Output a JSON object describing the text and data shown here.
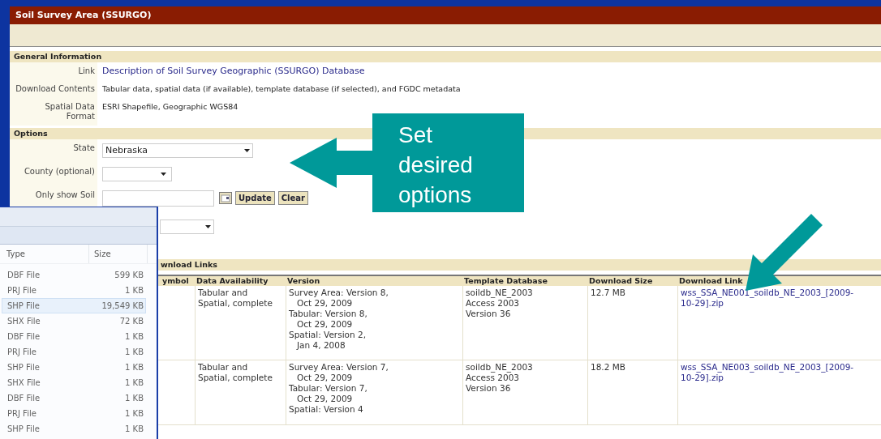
{
  "window_title": "Soil Survey Area (SSURGO)",
  "general_information": {
    "heading": "General Information",
    "rows": [
      {
        "label": "Link",
        "value": "Description of Soil Survey Geographic (SSURGO) Database",
        "kind": "link"
      },
      {
        "label": "Download Contents",
        "value": "Tabular data, spatial data (if available), template database (if selected), and FGDC metadata",
        "kind": "text"
      },
      {
        "label": "Spatial Data Format",
        "value": "ESRI Shapefile, Geographic WGS84",
        "kind": "text"
      }
    ]
  },
  "options": {
    "heading": "Options",
    "state": {
      "label": "State",
      "value": "Nebraska"
    },
    "county": {
      "label": "County (optional)"
    },
    "area_filter": {
      "label": "Only show Soil",
      "buttons": [
        "Update",
        "Clear"
      ]
    }
  },
  "download_links": {
    "heading": "wnload Links",
    "columns": [
      "ymbol",
      "Data Availability",
      "Version",
      "Template Database",
      "Download Size",
      "Download Link"
    ],
    "rows": [
      {
        "availability": "Tabular and Spatial, complete",
        "versions": [
          {
            "label": "Survey Area: Version 8,",
            "date": "Oct 29, 2009"
          },
          {
            "label": "Tabular: Version 8,",
            "date": "Oct 29, 2009"
          },
          {
            "label": "Spatial: Version 2,",
            "date": "Jan 4, 2008"
          }
        ],
        "template": [
          "soildb_NE_2003",
          "Access 2003",
          "Version 36"
        ],
        "size": "12.7 MB",
        "link": "wss_SSA_NE001_soildb_NE_2003_[2009-10-29].zip"
      },
      {
        "availability": "Tabular and Spatial, complete",
        "versions": [
          {
            "label": "Survey Area: Version 7,",
            "date": "Oct 29, 2009"
          },
          {
            "label": "Tabular: Version 7,",
            "date": "Oct 29, 2009"
          },
          {
            "label": "Spatial: Version 4"
          }
        ],
        "template": [
          "soildb_NE_2003",
          "Access 2003",
          "Version 36"
        ],
        "size": "18.2 MB",
        "link": "wss_SSA_NE003_soildb_NE_2003_[2009-10-29].zip"
      }
    ]
  },
  "file_window": {
    "columns": [
      "Type",
      "Size"
    ],
    "files": [
      {
        "type": "DBF File",
        "size": "599 KB",
        "selected": false
      },
      {
        "type": "PRJ File",
        "size": "1 KB",
        "selected": false
      },
      {
        "type": "SHP File",
        "size": "19,549 KB",
        "selected": true
      },
      {
        "type": "SHX File",
        "size": "72 KB",
        "selected": false
      },
      {
        "type": "DBF File",
        "size": "1 KB",
        "selected": false
      },
      {
        "type": "PRJ File",
        "size": "1 KB",
        "selected": false
      },
      {
        "type": "SHP File",
        "size": "1 KB",
        "selected": false
      },
      {
        "type": "SHX File",
        "size": "1 KB",
        "selected": false
      },
      {
        "type": "DBF File",
        "size": "1 KB",
        "selected": false
      },
      {
        "type": "PRJ File",
        "size": "1 KB",
        "selected": false
      },
      {
        "type": "SHP File",
        "size": "1 KB",
        "selected": false
      }
    ]
  },
  "callouts": [
    {
      "text": "Set desired options"
    }
  ]
}
